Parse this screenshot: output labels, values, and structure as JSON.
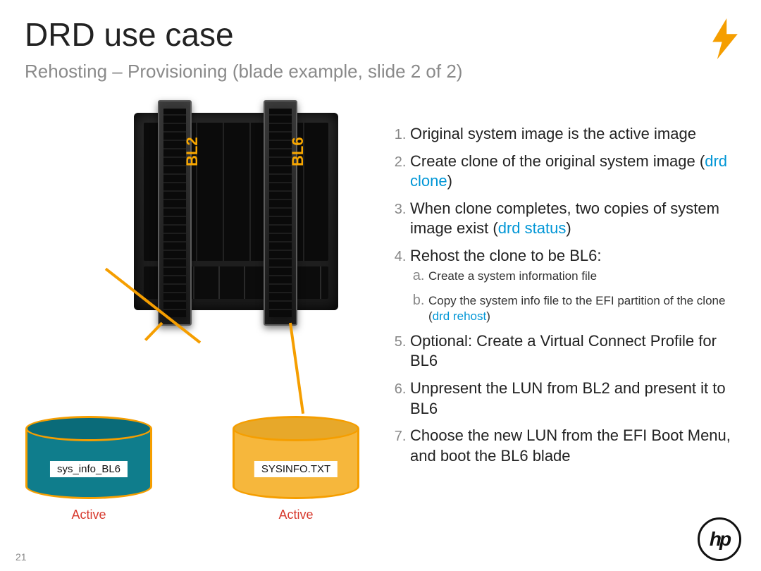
{
  "title": "DRD use case",
  "subtitle": "Rehosting – Provisioning (blade example, slide 2 of 2)",
  "page_number": "21",
  "blade_labels": {
    "left": "BL2",
    "right": "BL6"
  },
  "cylinders": {
    "left_tag": "sys_info_BL6",
    "right_tag": "SYSINFO.TXT",
    "left_status": "Active",
    "right_status": "Active"
  },
  "steps": {
    "s1": "Original system image is the active image",
    "s2a": "Create clone of the original system image (",
    "s2cmd": "drd clone",
    "s2b": ")",
    "s3a": "When clone completes, two copies of system image exist (",
    "s3cmd": "drd status",
    "s3b": ")",
    "s4": "Rehost the clone to be BL6:",
    "s4sub_a": "Create a system information file",
    "s4sub_b_a": "Copy the system info file to the EFI partition of the clone (",
    "s4sub_b_cmd": "drd rehost",
    "s4sub_b_b": ")",
    "s5": "Optional: Create a Virtual Connect Profile for BL6",
    "s6": "Unpresent the LUN from BL2 and present it to BL6",
    "s7": "Choose the new LUN from the EFI Boot Menu, and boot the BL6 blade"
  }
}
